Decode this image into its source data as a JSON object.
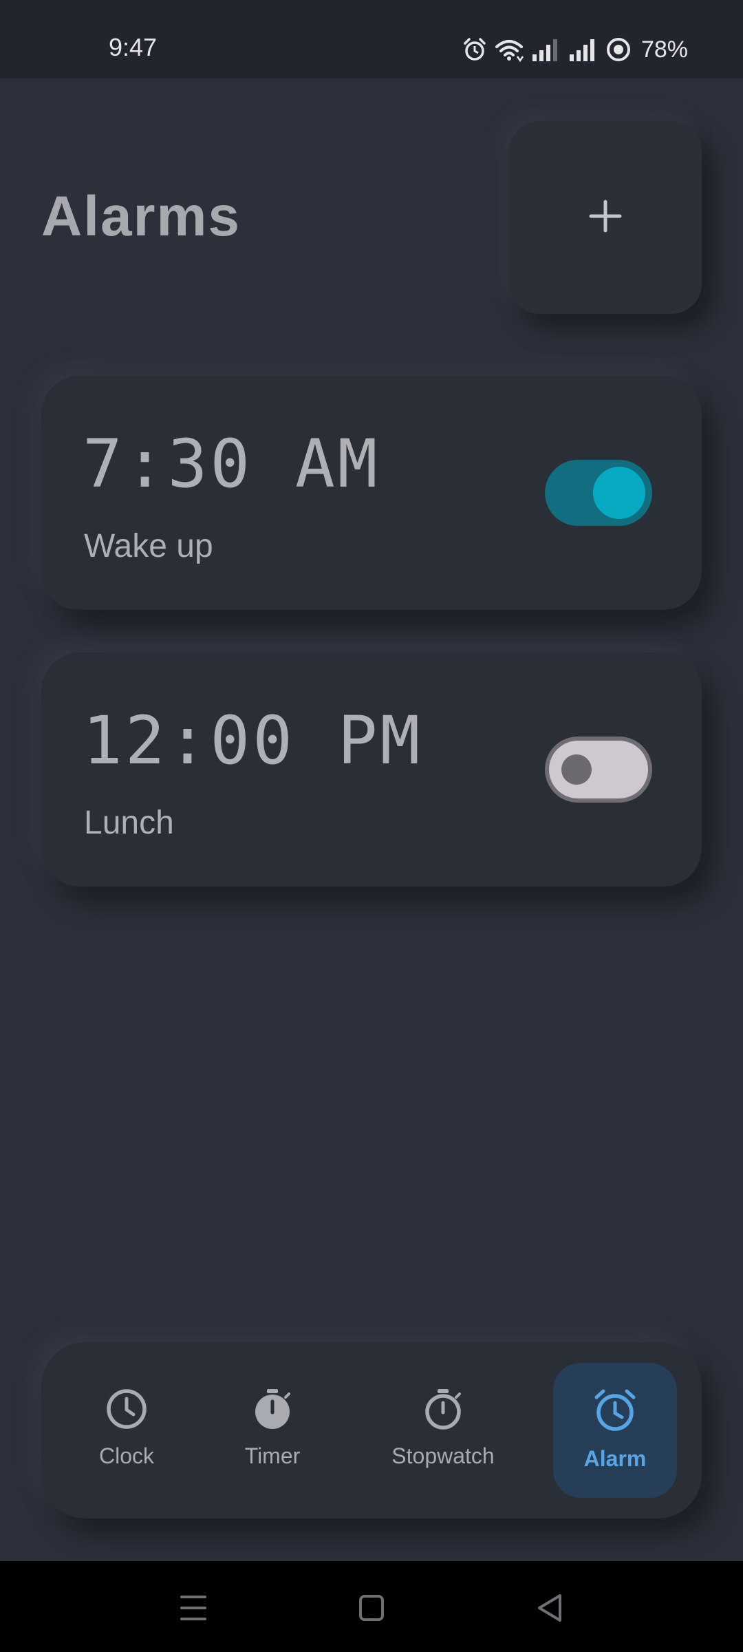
{
  "status_bar": {
    "time": "9:47",
    "battery": "78%",
    "icons": [
      "alarm-icon",
      "wifi-icon",
      "signal-icon",
      "signal-icon",
      "battery-icon"
    ]
  },
  "header": {
    "title": "Alarms",
    "add_icon": "plus-icon"
  },
  "alarms": [
    {
      "time": "7:30 AM",
      "label": "Wake up",
      "enabled": true
    },
    {
      "time": "12:00 PM",
      "label": "Lunch",
      "enabled": false
    }
  ],
  "bottom_nav": {
    "items": [
      {
        "label": "Clock",
        "icon": "clock-icon",
        "active": false
      },
      {
        "label": "Timer",
        "icon": "timer-icon",
        "active": false
      },
      {
        "label": "Stopwatch",
        "icon": "stopwatch-icon",
        "active": false
      },
      {
        "label": "Alarm",
        "icon": "alarm-clock-icon",
        "active": true
      }
    ]
  },
  "system_nav": {
    "icons": [
      "menu-icon",
      "home-icon",
      "back-icon"
    ]
  },
  "colors": {
    "background": "#2c303a",
    "accent": "#58a5e6",
    "toggle_on": "#07a9c3",
    "text": "#aeb0b5"
  }
}
